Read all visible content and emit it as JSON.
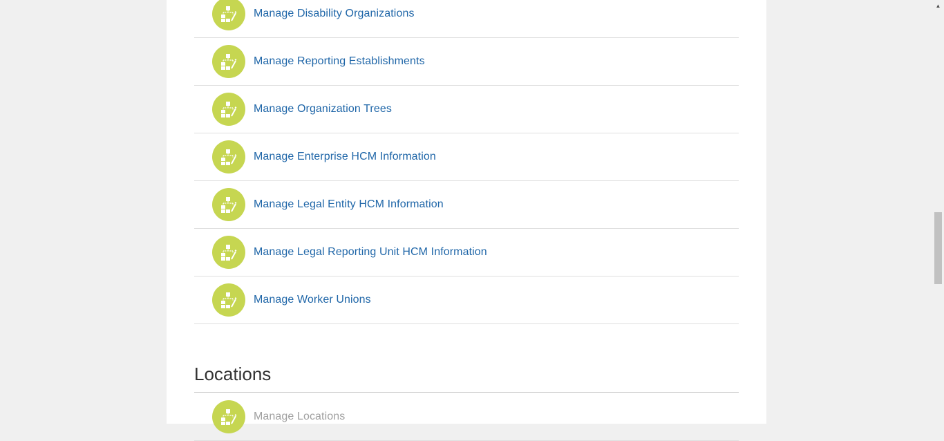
{
  "tasks": [
    {
      "label": "Manage Disability Organizations",
      "icon": "organization-edit-icon"
    },
    {
      "label": "Manage Reporting Establishments",
      "icon": "organization-edit-icon"
    },
    {
      "label": "Manage Organization Trees",
      "icon": "organization-edit-icon"
    },
    {
      "label": "Manage Enterprise HCM Information",
      "icon": "organization-edit-icon"
    },
    {
      "label": "Manage Legal Entity HCM Information",
      "icon": "organization-edit-icon"
    },
    {
      "label": "Manage Legal Reporting Unit HCM Information",
      "icon": "organization-edit-icon"
    },
    {
      "label": "Manage Worker Unions",
      "icon": "organization-edit-icon"
    }
  ],
  "locations": {
    "title": "Locations",
    "tasks": [
      {
        "label": "Manage Locations",
        "icon": "organization-edit-icon"
      }
    ]
  },
  "colors": {
    "icon_bg": "#c6d651",
    "link": "#1f66a8",
    "disabled_link": "#a0a0a0"
  },
  "scrollbar": {
    "up_arrow": "▲"
  }
}
